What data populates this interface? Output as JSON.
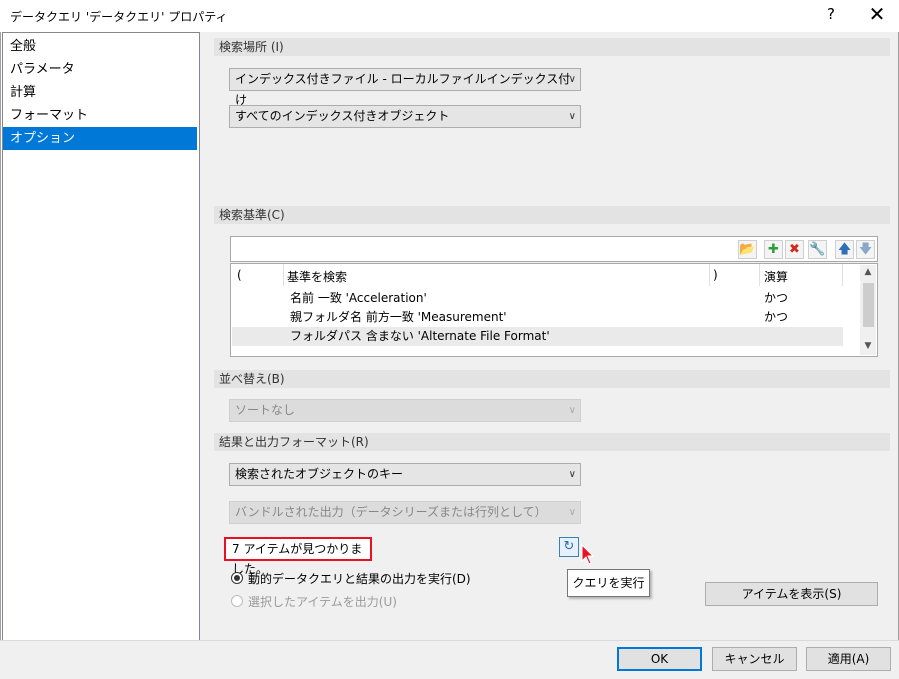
{
  "window": {
    "title": "データクエリ 'データクエリ' プロパティ",
    "help_label": "?",
    "close_label": "✕"
  },
  "nav": {
    "items": [
      {
        "label": "全般"
      },
      {
        "label": "パラメータ"
      },
      {
        "label": "計算"
      },
      {
        "label": "フォーマット"
      },
      {
        "label": "オプション",
        "selected": true
      }
    ]
  },
  "search_location": {
    "header": "検索場所 (I)",
    "combo1": "インデックス付きファイル - ローカルファイルインデックス付け",
    "combo2": "すべてのインデックス付きオブジェクト"
  },
  "search_criteria": {
    "header": "検索基準(C)",
    "toolbar_icons": [
      "open-folder-icon",
      "add-icon",
      "delete-icon",
      "wrench-icon",
      "move-up-icon",
      "move-down-icon"
    ],
    "columns": {
      "open_paren": "(",
      "criteria": "基準を検索",
      "close_paren": ")",
      "operator": "演算"
    },
    "rows": [
      {
        "criteria": "名前 一致 'Acceleration'",
        "operator": "かつ"
      },
      {
        "criteria": "親フォルダ名 前方一致 'Measurement'",
        "operator": "かつ"
      },
      {
        "criteria": "フォルダパス 含まない 'Alternate File Format'",
        "operator": ""
      }
    ]
  },
  "sort": {
    "header": "並べ替え(B)",
    "value": "ソートなし"
  },
  "results": {
    "header": "結果と出力フォーマット(R)",
    "combo1": "検索されたオブジェクトのキー",
    "combo2": "バンドルされた出力（データシリーズまたは行列として）",
    "found_text": "7 アイテムが見つかりました。",
    "tooltip": "クエリを実行",
    "radio1": "動的データクエリと結果の出力を実行(D)",
    "radio2": "選択したアイテムを出力(U)",
    "show_items": "アイテムを表示(S)"
  },
  "footer": {
    "ok": "OK",
    "cancel": "キャンセル",
    "apply": "適用(A)"
  },
  "colors": {
    "accent": "#0078d7",
    "highlight_box": "#e81123",
    "panel": "#f0f0f0"
  }
}
